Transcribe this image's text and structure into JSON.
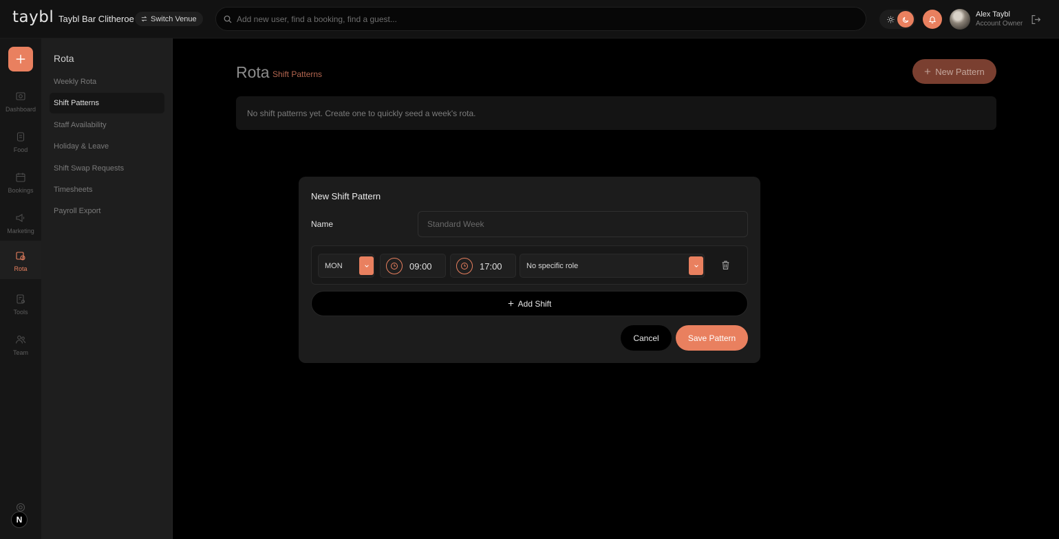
{
  "header": {
    "logo": "taybl",
    "venue_name": "Taybl Bar Clitheroe",
    "switch_venue_label": "Switch Venue",
    "search_placeholder": "Add new user, find a booking, find a guest...",
    "user_name": "Alex Taybl",
    "user_role": "Account Owner"
  },
  "nav": {
    "items": [
      {
        "label": "Dashboard",
        "icon": "dashboard-icon"
      },
      {
        "label": "Food",
        "icon": "food-icon"
      },
      {
        "label": "Bookings",
        "icon": "bookings-icon"
      },
      {
        "label": "Marketing",
        "icon": "marketing-icon"
      },
      {
        "label": "Rota",
        "icon": "rota-icon",
        "active": true
      },
      {
        "label": "Tools",
        "icon": "tools-icon"
      },
      {
        "label": "Team",
        "icon": "team-icon"
      }
    ],
    "badge_letter": "N"
  },
  "subnav": {
    "title": "Rota",
    "items": [
      {
        "label": "Weekly Rota"
      },
      {
        "label": "Shift Patterns",
        "active": true
      },
      {
        "label": "Staff Availability"
      },
      {
        "label": "Holiday & Leave"
      },
      {
        "label": "Shift Swap Requests"
      },
      {
        "label": "Timesheets"
      },
      {
        "label": "Payroll Export"
      }
    ]
  },
  "main": {
    "title": "Rota",
    "subtitle": "Shift Patterns",
    "new_pattern_label": "New Pattern",
    "empty_message": "No shift patterns yet. Create one to quickly seed a week's rota."
  },
  "modal": {
    "title": "New Shift Pattern",
    "name_label": "Name",
    "name_placeholder": "Standard Week",
    "shift": {
      "day": "MON",
      "start": "09:00",
      "end": "17:00",
      "role": "No specific role"
    },
    "add_shift_label": "Add Shift",
    "cancel_label": "Cancel",
    "save_label": "Save Pattern"
  },
  "colors": {
    "accent": "#e9805f",
    "accent_dim": "#7a3f30",
    "background": "#000000",
    "sidebar": "#1e1e1e"
  }
}
